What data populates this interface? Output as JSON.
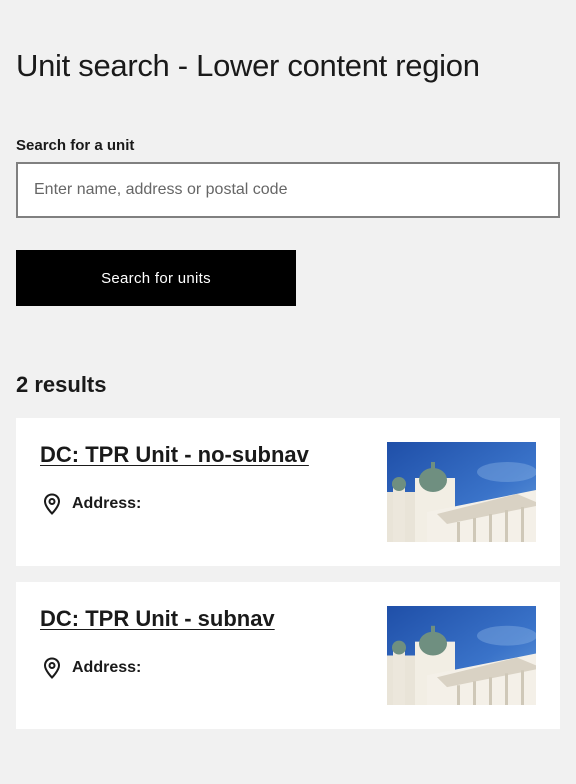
{
  "page": {
    "title": "Unit search - Lower content region"
  },
  "search": {
    "label": "Search for a unit",
    "placeholder": "Enter name, address or postal code",
    "value": "",
    "button_label": "Search for units"
  },
  "results": {
    "count_label": "2 results",
    "items": [
      {
        "title": "DC: TPR Unit - no-subnav",
        "address_label": "Address:",
        "image_icon": "cathedral-photo"
      },
      {
        "title": "DC: TPR Unit - subnav",
        "address_label": "Address:",
        "image_icon": "cathedral-photo"
      }
    ]
  },
  "colors": {
    "background": "#f1f1f1",
    "button": "#000000",
    "card": "#ffffff",
    "input_border": "#808080"
  }
}
